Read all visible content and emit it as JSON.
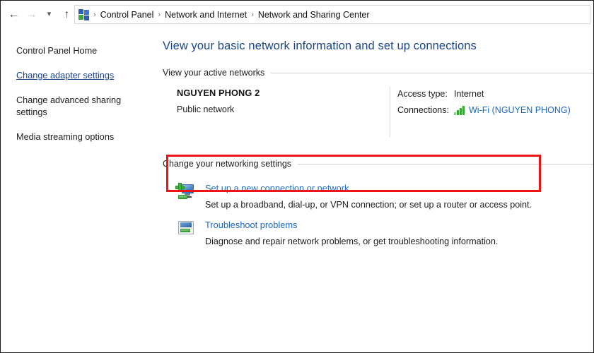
{
  "navbar": {
    "back_icon": "back-arrow-icon",
    "forward_icon": "forward-arrow-icon",
    "recent_icon": "chevron-down-icon",
    "up_icon": "up-arrow-icon",
    "address_icon": "control-panel-icon",
    "breadcrumbs": [
      {
        "label": "Control Panel"
      },
      {
        "label": "Network and Internet"
      },
      {
        "label": "Network and Sharing Center"
      }
    ],
    "separator": "›"
  },
  "sidebar": {
    "items": [
      {
        "label": "Control Panel Home",
        "link": false
      },
      {
        "label": "Change adapter settings",
        "link": true
      },
      {
        "label": "Change advanced sharing settings",
        "link": false
      },
      {
        "label": "Media streaming options",
        "link": false
      }
    ]
  },
  "main": {
    "title": "View your basic network information and set up connections",
    "active_networks_heading": "View your active networks",
    "network": {
      "name": "NGUYEN PHONG 2",
      "type": "Public network",
      "access_type_label": "Access type:",
      "access_type_value": "Internet",
      "connections_label": "Connections:",
      "connections_value": "Wi-Fi (NGUYEN PHONG)",
      "connections_icon": "wifi-signal-bars-icon"
    },
    "settings_heading": "Change your networking settings",
    "tasks": [
      {
        "icon": "new-connection-icon",
        "link": "Set up a new connection or network",
        "description": "Set up a broadband, dial-up, or VPN connection; or set up a router or access point."
      },
      {
        "icon": "troubleshoot-icon",
        "link": "Troubleshoot problems",
        "description": "Diagnose and repair network problems, or get troubleshooting information."
      }
    ]
  },
  "annotation": {
    "highlight_color": "#f01313",
    "target": "Set up a new connection or network"
  },
  "colors": {
    "title_blue": "#1c4587",
    "link_blue": "#1b68c4",
    "sidebar_link_blue": "#17418f",
    "signal_green": "#36a536"
  }
}
